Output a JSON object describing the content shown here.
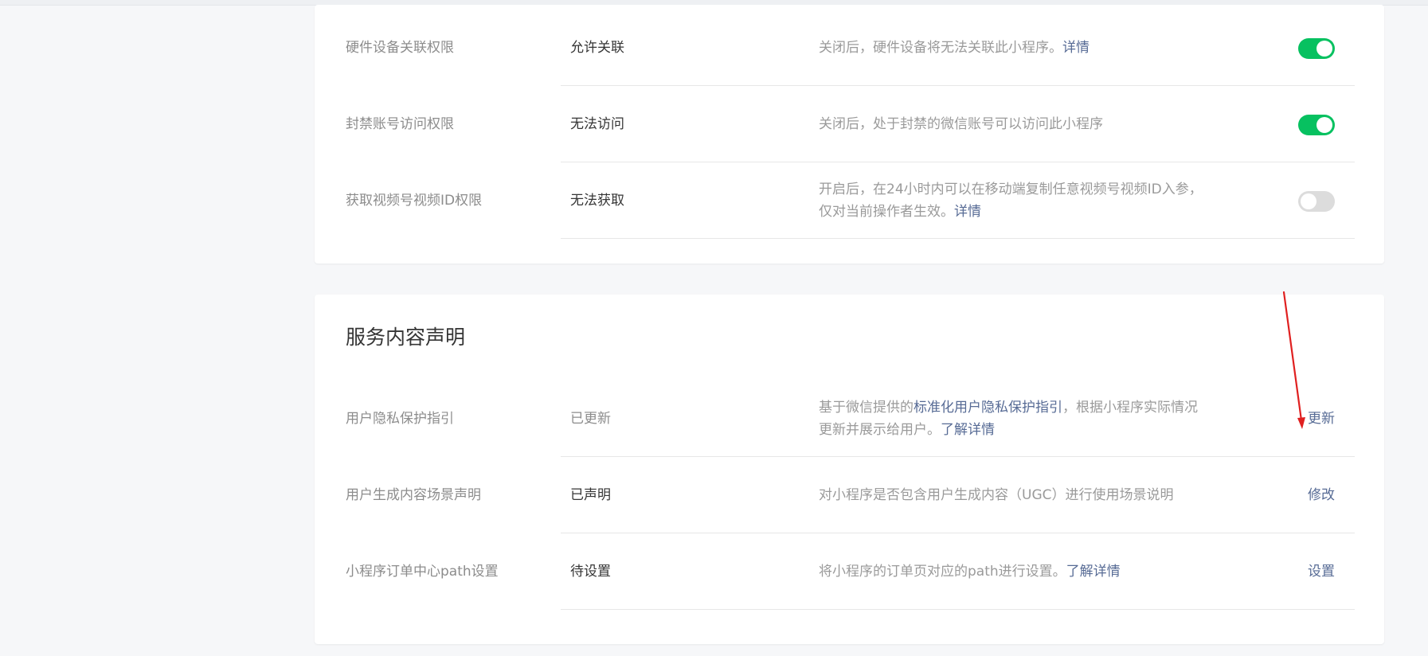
{
  "permissions": {
    "rows": [
      {
        "name": "硬件设备关联权限",
        "status": "允许关联",
        "desc": "关闭后，硬件设备将无法关联此小程序。",
        "desc_link": "详情",
        "toggle": "on"
      },
      {
        "name": "封禁账号访问权限",
        "status": "无法访问",
        "desc": "关闭后，处于封禁的微信账号可以访问此小程序",
        "desc_link": "",
        "toggle": "on"
      },
      {
        "name": "获取视频号视频ID权限",
        "status": "无法获取",
        "desc_line1": "开启后，在24小时内可以在移动端复制任意视频号视频ID入参，",
        "desc_line2": "仅对当前操作者生效。",
        "desc_link": "详情",
        "toggle": "off"
      }
    ]
  },
  "service": {
    "title": "服务内容声明",
    "rows": [
      {
        "name": "用户隐私保护指引",
        "status": "已更新",
        "desc_pre": "基于微信提供的",
        "desc_link1": "标准化用户隐私保护指引",
        "desc_mid": "，根据小程序实际情况",
        "desc_line2": "更新并展示给用户。",
        "desc_link2": "了解详情",
        "action": "更新"
      },
      {
        "name": "用户生成内容场景声明",
        "status": "已声明",
        "desc": "对小程序是否包含用户生成内容（UGC）进行使用场景说明",
        "action": "修改"
      },
      {
        "name": "小程序订单中心path设置",
        "status": "待设置",
        "desc": "将小程序的订单页对应的path进行设置。",
        "desc_link": "了解详情",
        "action": "设置"
      }
    ]
  },
  "colors": {
    "toggle_on": "#07c160",
    "toggle_off": "#dcdcdc",
    "link": "#576b95",
    "annotation_arrow": "#e02020"
  }
}
